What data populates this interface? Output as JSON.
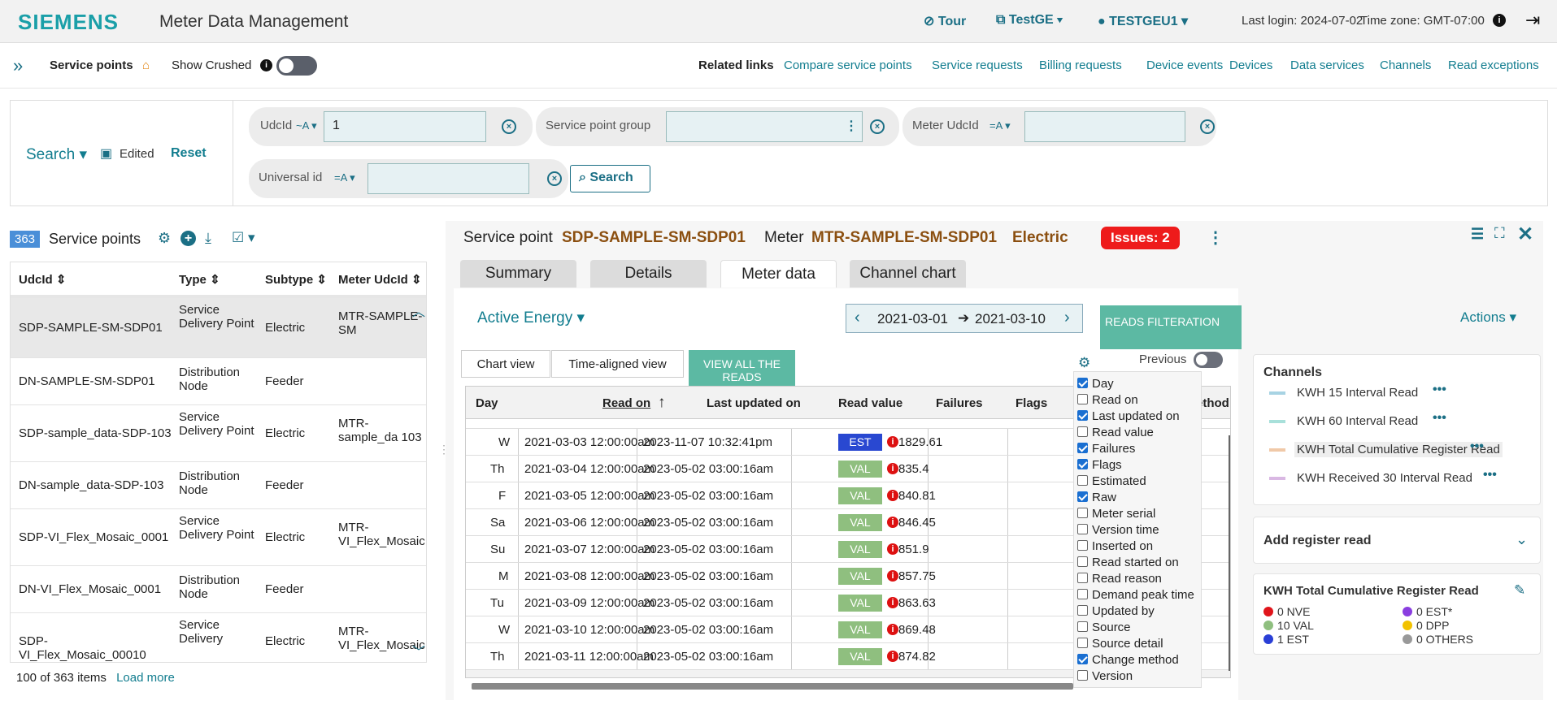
{
  "header": {
    "logo": "SIEMENS",
    "app_title": "Meter Data Management",
    "tour": "Tour",
    "tenant": "TestGE",
    "user": "TESTGEU1",
    "last_login": "Last login: 2024-07-02",
    "time_zone": "Time zone: GMT-07:00"
  },
  "nav": {
    "title": "Service points",
    "show_crushed": "Show Crushed",
    "related_label": "Related links",
    "links": [
      "Compare service points",
      "Service requests",
      "Billing requests",
      "Device events",
      "Devices",
      "Data services",
      "Channels",
      "Read exceptions"
    ]
  },
  "search": {
    "search_label": "Search",
    "edited": "Edited",
    "reset": "Reset",
    "fields": [
      {
        "label": "UdcId",
        "op": "~A",
        "value": "1"
      },
      {
        "label": "Service point group",
        "op": "",
        "value": ""
      },
      {
        "label": "Meter UdcId",
        "op": "=A",
        "value": ""
      },
      {
        "label": "Universal id",
        "op": "=A",
        "value": ""
      }
    ],
    "search_button": "Search"
  },
  "list": {
    "count": "363",
    "title": "Service points",
    "columns": [
      "UdcId",
      "Type",
      "Subtype",
      "Meter UdcId"
    ],
    "rows": [
      {
        "udcid": "SDP-SAMPLE-SM-SDP01",
        "type": "Service Delivery Point",
        "subtype": "Electric",
        "meter": "MTR-SAMPLE-SM"
      },
      {
        "udcid": "DN-SAMPLE-SM-SDP01",
        "type": "Distribution Node",
        "subtype": "Feeder",
        "meter": ""
      },
      {
        "udcid": "SDP-sample_data-SDP-103",
        "type": "Service Delivery Point",
        "subtype": "Electric",
        "meter": "MTR-sample_da 103"
      },
      {
        "udcid": "DN-sample_data-SDP-103",
        "type": "Distribution Node",
        "subtype": "Feeder",
        "meter": ""
      },
      {
        "udcid": "SDP-VI_Flex_Mosaic_0001",
        "type": "Service Delivery Point",
        "subtype": "Electric",
        "meter": "MTR-VI_Flex_Mosaic"
      },
      {
        "udcid": "DN-VI_Flex_Mosaic_0001",
        "type": "Distribution Node",
        "subtype": "Feeder",
        "meter": ""
      },
      {
        "udcid": "SDP-VI_Flex_Mosaic_00010",
        "type": "Service Delivery",
        "subtype": "Electric",
        "meter": "MTR-VI_Flex_Mosaic"
      }
    ],
    "footer": "100 of 363  items",
    "load_more": "Load more"
  },
  "detail": {
    "sp_label": "Service point",
    "sp_value": "SDP-SAMPLE-SM-SDP01",
    "meter_label": "Meter",
    "meter_value": "MTR-SAMPLE-SM-SDP01",
    "kind": "Electric",
    "issues": "Issues: 2",
    "tabs": [
      "Summary",
      "Details",
      "Meter data",
      "Channel chart"
    ],
    "energy": "Active Energy",
    "date_from": "2021-03-01",
    "date_to": "2021-03-10",
    "reads_filter": "READS FILTERATION",
    "actions": "Actions",
    "chart_view": "Chart view",
    "time_aligned": "Time-aligned view",
    "view_all": "VIEW ALL THE READS",
    "previous": "Previous",
    "grid_headers": [
      "Day",
      "Read on",
      "Last updated on",
      "Read value",
      "Failures",
      "Flags",
      "ethod"
    ],
    "rows": [
      {
        "day": "W",
        "read_on": "2021-03-03 12:00:00am",
        "updated": "2023-11-07 10:32:41pm",
        "flag": "EST",
        "value": "1829.61"
      },
      {
        "day": "Th",
        "read_on": "2021-03-04 12:00:00am",
        "updated": "2023-05-02 03:00:16am",
        "flag": "VAL",
        "value": "835.4"
      },
      {
        "day": "F",
        "read_on": "2021-03-05 12:00:00am",
        "updated": "2023-05-02 03:00:16am",
        "flag": "VAL",
        "value": "840.81"
      },
      {
        "day": "Sa",
        "read_on": "2021-03-06 12:00:00am",
        "updated": "2023-05-02 03:00:16am",
        "flag": "VAL",
        "value": "846.45"
      },
      {
        "day": "Su",
        "read_on": "2021-03-07 12:00:00am",
        "updated": "2023-05-02 03:00:16am",
        "flag": "VAL",
        "value": "851.9"
      },
      {
        "day": "M",
        "read_on": "2021-03-08 12:00:00am",
        "updated": "2023-05-02 03:00:16am",
        "flag": "VAL",
        "value": "857.75"
      },
      {
        "day": "Tu",
        "read_on": "2021-03-09 12:00:00am",
        "updated": "2023-05-02 03:00:16am",
        "flag": "VAL",
        "value": "863.63"
      },
      {
        "day": "W",
        "read_on": "2021-03-10 12:00:00am",
        "updated": "2023-05-02 03:00:16am",
        "flag": "VAL",
        "value": "869.48"
      },
      {
        "day": "Th",
        "read_on": "2021-03-11 12:00:00am",
        "updated": "2023-05-02 03:00:16am",
        "flag": "VAL",
        "value": "874.82"
      }
    ],
    "columns_menu": [
      {
        "label": "Day",
        "checked": true
      },
      {
        "label": "Read on",
        "checked": false
      },
      {
        "label": "Last updated on",
        "checked": true
      },
      {
        "label": "Read value",
        "checked": false
      },
      {
        "label": "Failures",
        "checked": true
      },
      {
        "label": "Flags",
        "checked": true
      },
      {
        "label": "Estimated",
        "checked": false
      },
      {
        "label": "Raw",
        "checked": true
      },
      {
        "label": "Meter serial",
        "checked": false
      },
      {
        "label": "Version time",
        "checked": false
      },
      {
        "label": "Inserted on",
        "checked": false
      },
      {
        "label": "Read started on",
        "checked": false
      },
      {
        "label": "Read reason",
        "checked": false
      },
      {
        "label": "Demand peak time",
        "checked": false
      },
      {
        "label": "Updated by",
        "checked": false
      },
      {
        "label": "Source",
        "checked": false
      },
      {
        "label": "Source detail",
        "checked": false
      },
      {
        "label": "Change method",
        "checked": true
      },
      {
        "label": "Version",
        "checked": false
      }
    ]
  },
  "channels": {
    "title": "Channels",
    "items": [
      {
        "label": "KWH 15 Interval Read",
        "color": "#a7d3e3"
      },
      {
        "label": "KWH 60 Interval Read",
        "color": "#a8e0da"
      },
      {
        "label": "KWH Total Cumulative Register Read",
        "color": "#f0c9a8"
      },
      {
        "label": "KWH Received 30 Interval Read",
        "color": "#d9b8e3"
      }
    ],
    "add_register": "Add register read",
    "summary_title": "KWH Total Cumulative Register Read",
    "legend": [
      {
        "label": "0 NVE",
        "color": "#e0151b"
      },
      {
        "label": "0 EST*",
        "color": "#8a3ee0"
      },
      {
        "label": "10 VAL",
        "color": "#8fbf7f"
      },
      {
        "label": "0 DPP",
        "color": "#f2c200"
      },
      {
        "label": "1 EST",
        "color": "#2a3fd6"
      },
      {
        "label": "0 OTHERS",
        "color": "#999999"
      }
    ]
  }
}
